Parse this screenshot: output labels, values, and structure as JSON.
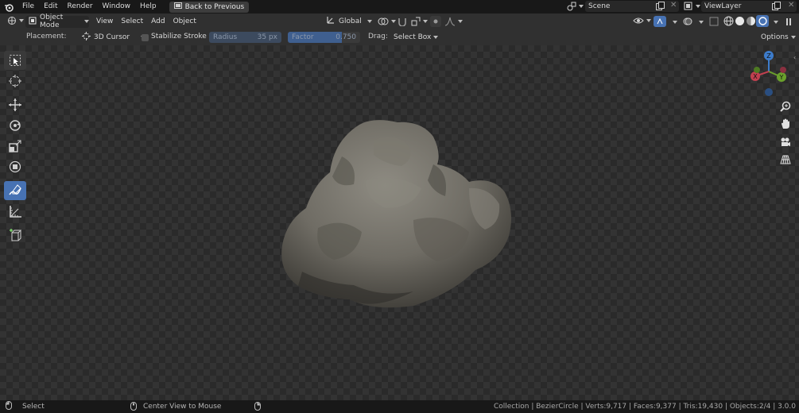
{
  "topbar": {
    "menus": [
      "File",
      "Edit",
      "Render",
      "Window",
      "Help"
    ],
    "back_button": "Back to Previous",
    "scene": "Scene",
    "view_layer": "ViewLayer"
  },
  "header": {
    "mode": "Object Mode",
    "menus": [
      "View",
      "Select",
      "Add",
      "Object"
    ],
    "orientation": "Global"
  },
  "tool_settings": {
    "placement_label": "Placement:",
    "placement_value": "3D Cursor",
    "stabilize_label": "Stabilize Stroke",
    "radius_label": "Radius",
    "radius_value": "35 px",
    "factor_label": "Factor",
    "factor_value": "0.750",
    "drag_label": "Drag:",
    "drag_value": "Select Box",
    "options_label": "Options"
  },
  "gizmo": {
    "z": "Z",
    "y": "Y",
    "x": "X"
  },
  "status": {
    "left_action": "Select",
    "middle_action": "Center View to Mouse",
    "stats": "Collection | BezierCircle | Verts:9,717 | Faces:9,377 | Tris:19,430 | Objects:2/4 | 3.0.0"
  },
  "colors": {
    "accent": "#4772b3",
    "x_axis": "#c0404f",
    "y_axis": "#6aa02c",
    "z_axis": "#3d7ccb"
  }
}
